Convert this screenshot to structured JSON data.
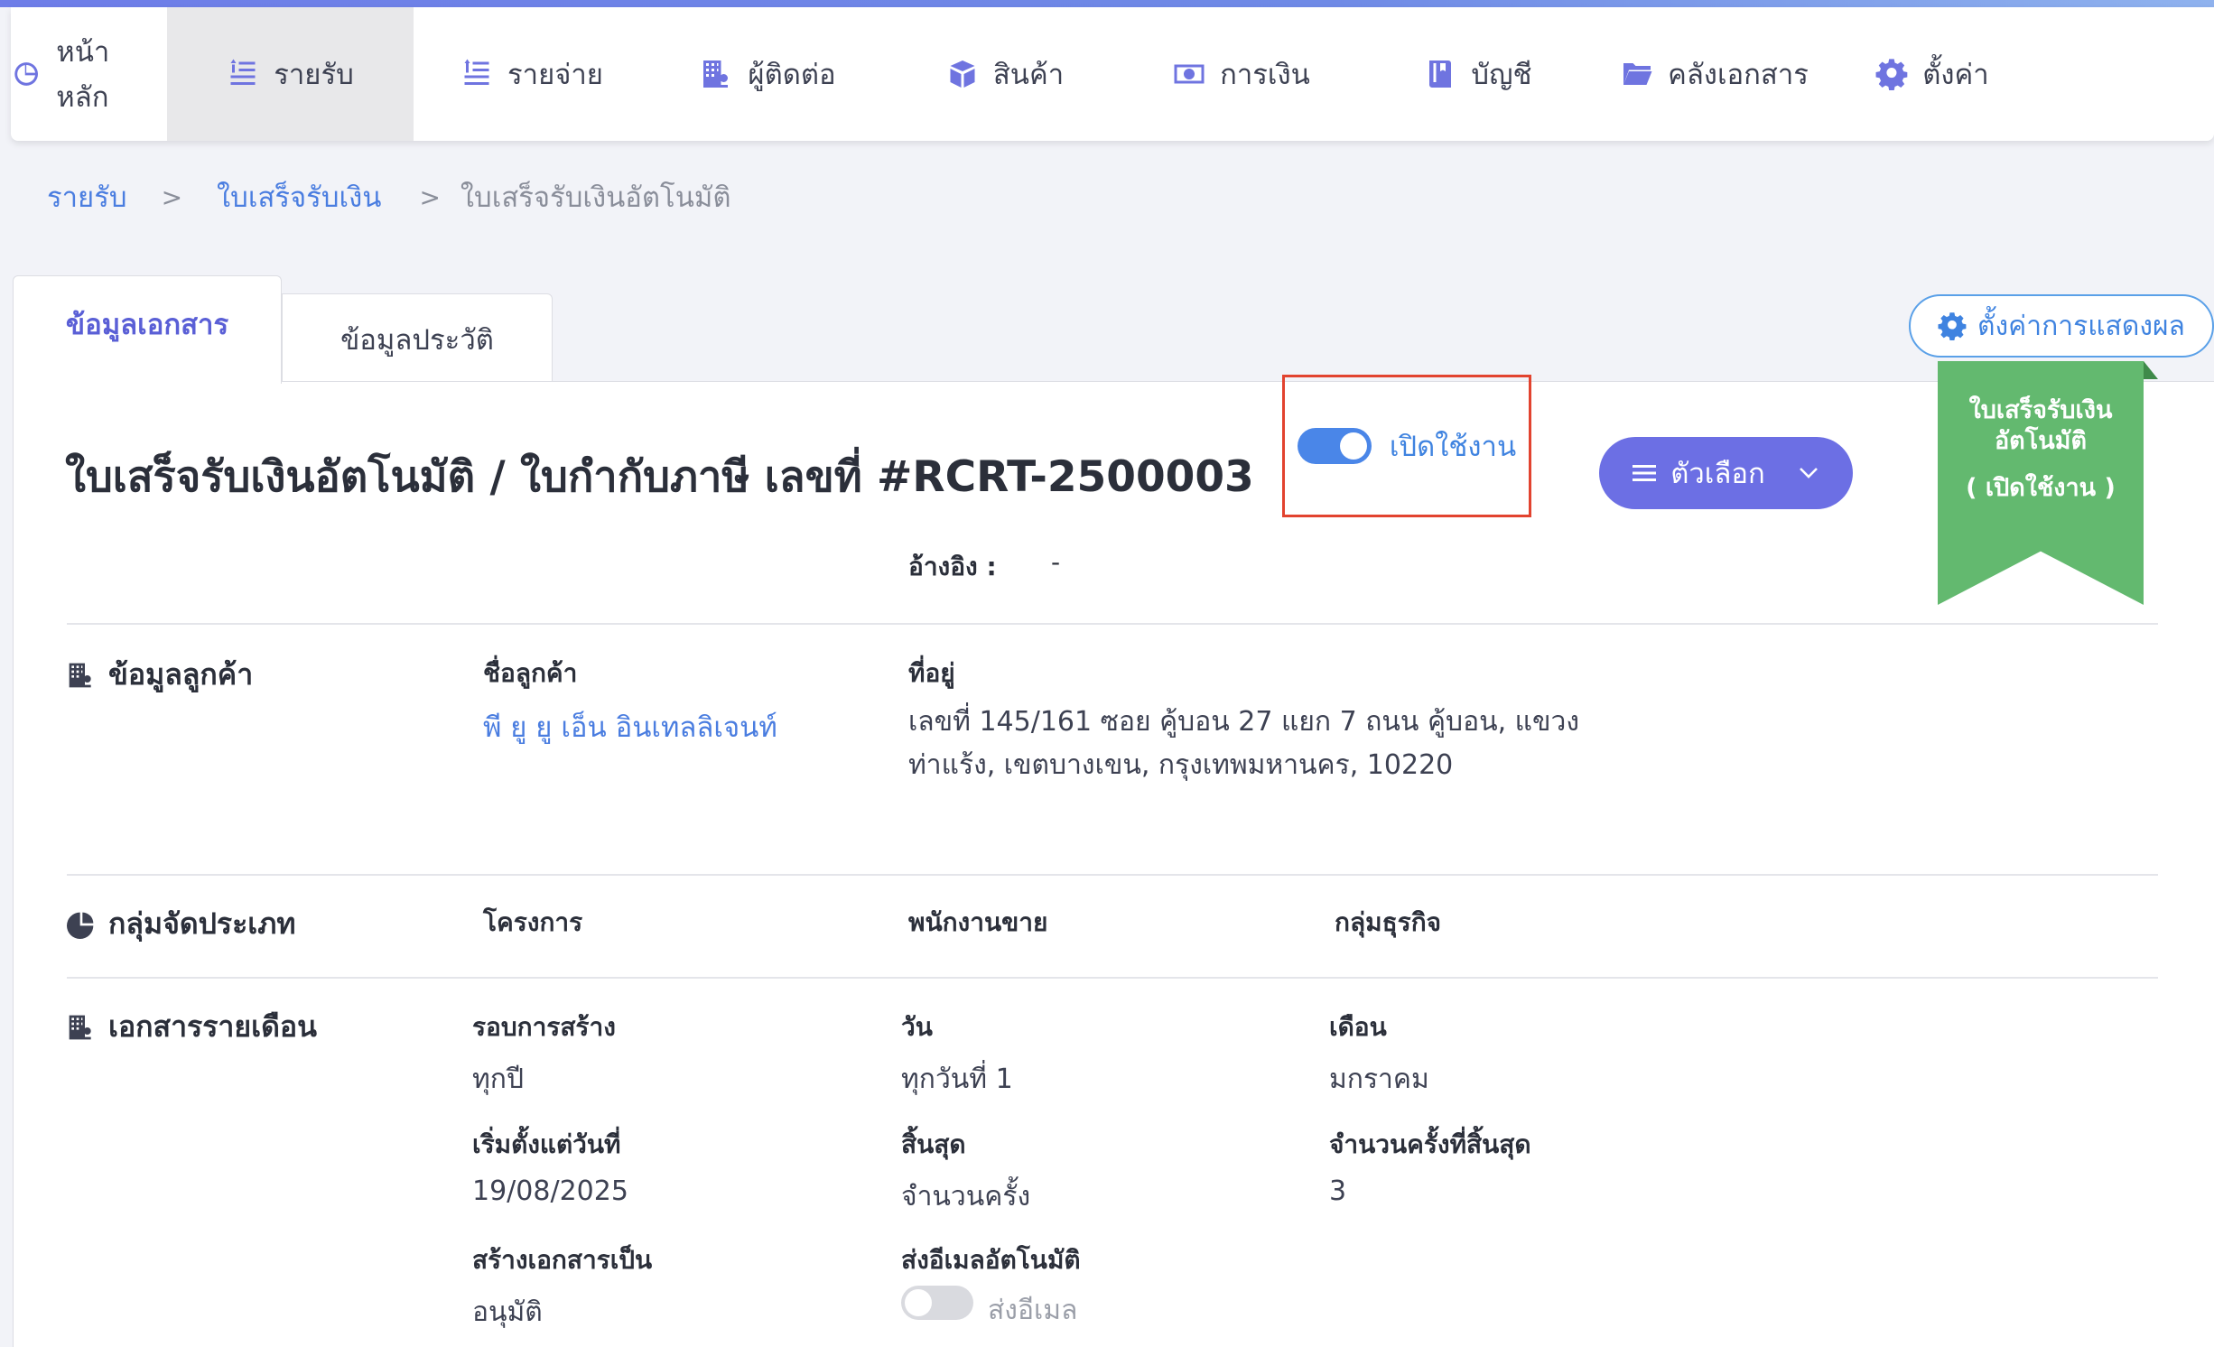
{
  "nav": {
    "items": [
      {
        "label": "หน้าหลัก",
        "icon": "dashboard-icon"
      },
      {
        "label": "รายรับ",
        "icon": "income-icon"
      },
      {
        "label": "รายจ่าย",
        "icon": "expense-icon"
      },
      {
        "label": "ผู้ติดต่อ",
        "icon": "contacts-icon"
      },
      {
        "label": "สินค้า",
        "icon": "box-icon"
      },
      {
        "label": "การเงิน",
        "icon": "money-icon"
      },
      {
        "label": "บัญชี",
        "icon": "book-icon"
      },
      {
        "label": "คลังเอกสาร",
        "icon": "folder-icon"
      },
      {
        "label": "ตั้งค่า",
        "icon": "gear-icon"
      }
    ],
    "active_index": 1
  },
  "breadcrumb": {
    "level1": "รายรับ",
    "level2": "ใบเสร็จรับเงิน",
    "current": "ใบเสร็จรับเงินอัตโนมัติ",
    "separator": ">"
  },
  "tabs": {
    "document": "ข้อมูลเอกสาร",
    "history": "ข้อมูลประวัติ"
  },
  "display_settings_label": "ตั้งค่าการแสดงผล",
  "document": {
    "title": "ใบเสร็จรับเงินอัตโนมัติ / ใบกำกับภาษี เลขที่ #RCRT-2500003",
    "status_label": "เปิดใช้งาน",
    "status_enabled": true,
    "options_label": "ตัวเลือก",
    "reference_label": "อ้างอิง :",
    "reference_value": "-"
  },
  "ribbon": {
    "line1": "ใบเสร็จรับเงิน",
    "line2": "อัตโนมัติ",
    "line3": "( เปิดใช้งาน )",
    "color": "#63b96f"
  },
  "customer": {
    "section_title": "ข้อมูลลูกค้า",
    "name_label": "ชื่อลูกค้า",
    "name_value": "พี ยู ยู เอ็น อินเทลลิเจนท์",
    "address_label": "ที่อยู่",
    "address_value": "เลขที่ 145/161 ซอย คู้บอน 27 แยก 7 ถนน คู้บอน, แขวงท่าแร้ง, เขตบางเขน, กรุงเทพมหานคร, 10220"
  },
  "classification": {
    "section_title": "กลุ่มจัดประเภท",
    "project_label": "โครงการ",
    "salesperson_label": "พนักงานขาย",
    "business_group_label": "กลุ่มธุรกิจ"
  },
  "monthly": {
    "section_title": "เอกสารรายเดือน",
    "cycle_label": "รอบการสร้าง",
    "cycle_value": "ทุกปี",
    "day_label": "วัน",
    "day_value": "ทุกวันที่ 1",
    "month_label": "เดือน",
    "month_value": "มกราคม",
    "start_label": "เริ่มตั้งแต่วันที่",
    "start_value": "19/08/2025",
    "end_label": "สิ้นสุด",
    "end_value": "จำนวนครั้ง",
    "end_count_label": "จำนวนครั้งที่สิ้นสุด",
    "end_count_value": "3",
    "create_as_label": "สร้างเอกสารเป็น",
    "create_as_value": "อนุมัติ",
    "auto_email_label": "ส่งอีเมลอัตโนมัติ",
    "send_email_label": "ส่งอีเมล",
    "auto_email_enabled": false
  },
  "colors": {
    "accent": "#6c6fe4",
    "link": "#4a7de0",
    "highlight_box": "#e2432f"
  }
}
